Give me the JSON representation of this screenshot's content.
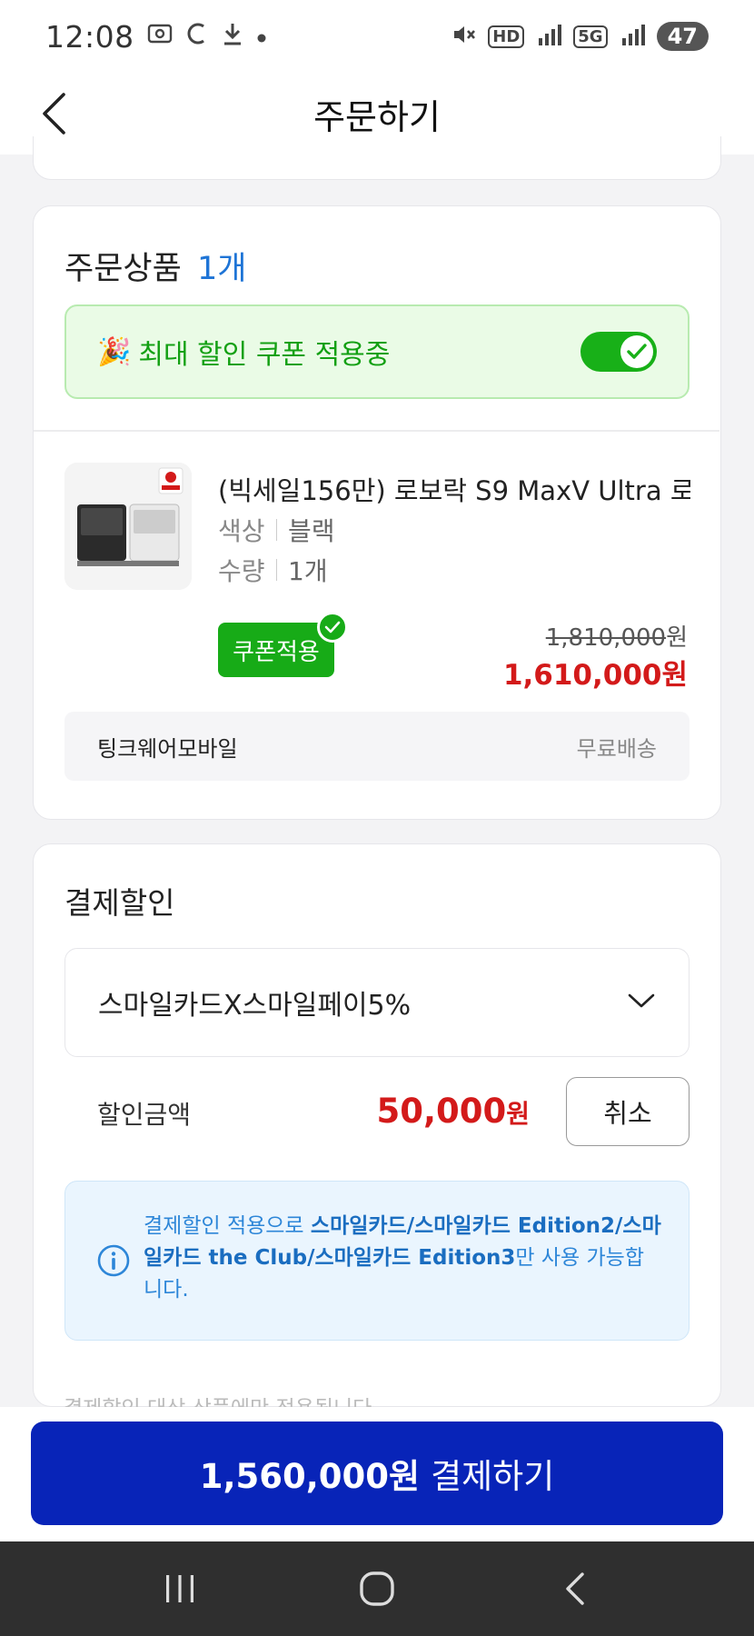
{
  "status_bar": {
    "time": "12:08",
    "battery": "47",
    "network_hd": "HD",
    "network_5g": "5G"
  },
  "header": {
    "title": "주문하기"
  },
  "order": {
    "title": "주문상품",
    "count": "1개",
    "coupon_banner_text": "최대 할인 쿠폰 적용중",
    "coupon_toggle_on": true,
    "product": {
      "name": "(빅세일156만) 로보락 S9 MaxV Ultra 로...",
      "color_label": "색상",
      "color_value": "블랙",
      "qty_label": "수량",
      "qty_value": "1개",
      "coupon_label": "쿠폰적용",
      "original_price": "1,810,000",
      "sale_price": "1,610,000원",
      "currency": "원"
    },
    "seller": "팅크웨어모바일",
    "shipping": "무료배송"
  },
  "payment_discount": {
    "title": "결제할인",
    "selected_card": "스마일카드X스마일페이5%",
    "discount_label": "할인금액",
    "discount_amount": "50,000",
    "discount_unit": "원",
    "cancel_label": "취소",
    "info_prefix": "결제할인 적용으로 ",
    "info_bold": "스마일카드/스마일카드 Edition2/스마일카드 the Club/스마일카드 Edition3",
    "info_suffix": "만 사용 가능합니다.",
    "fade_note": "결제할인 대상 상품에만 적용됩니다"
  },
  "checkout": {
    "amount": "1,560,000원",
    "label": "결제하기"
  },
  "colors": {
    "primary_button": "#0824b8",
    "coupon_green": "#17ab17",
    "price_red": "#d31a1a",
    "info_blue": "#2d86d8"
  }
}
